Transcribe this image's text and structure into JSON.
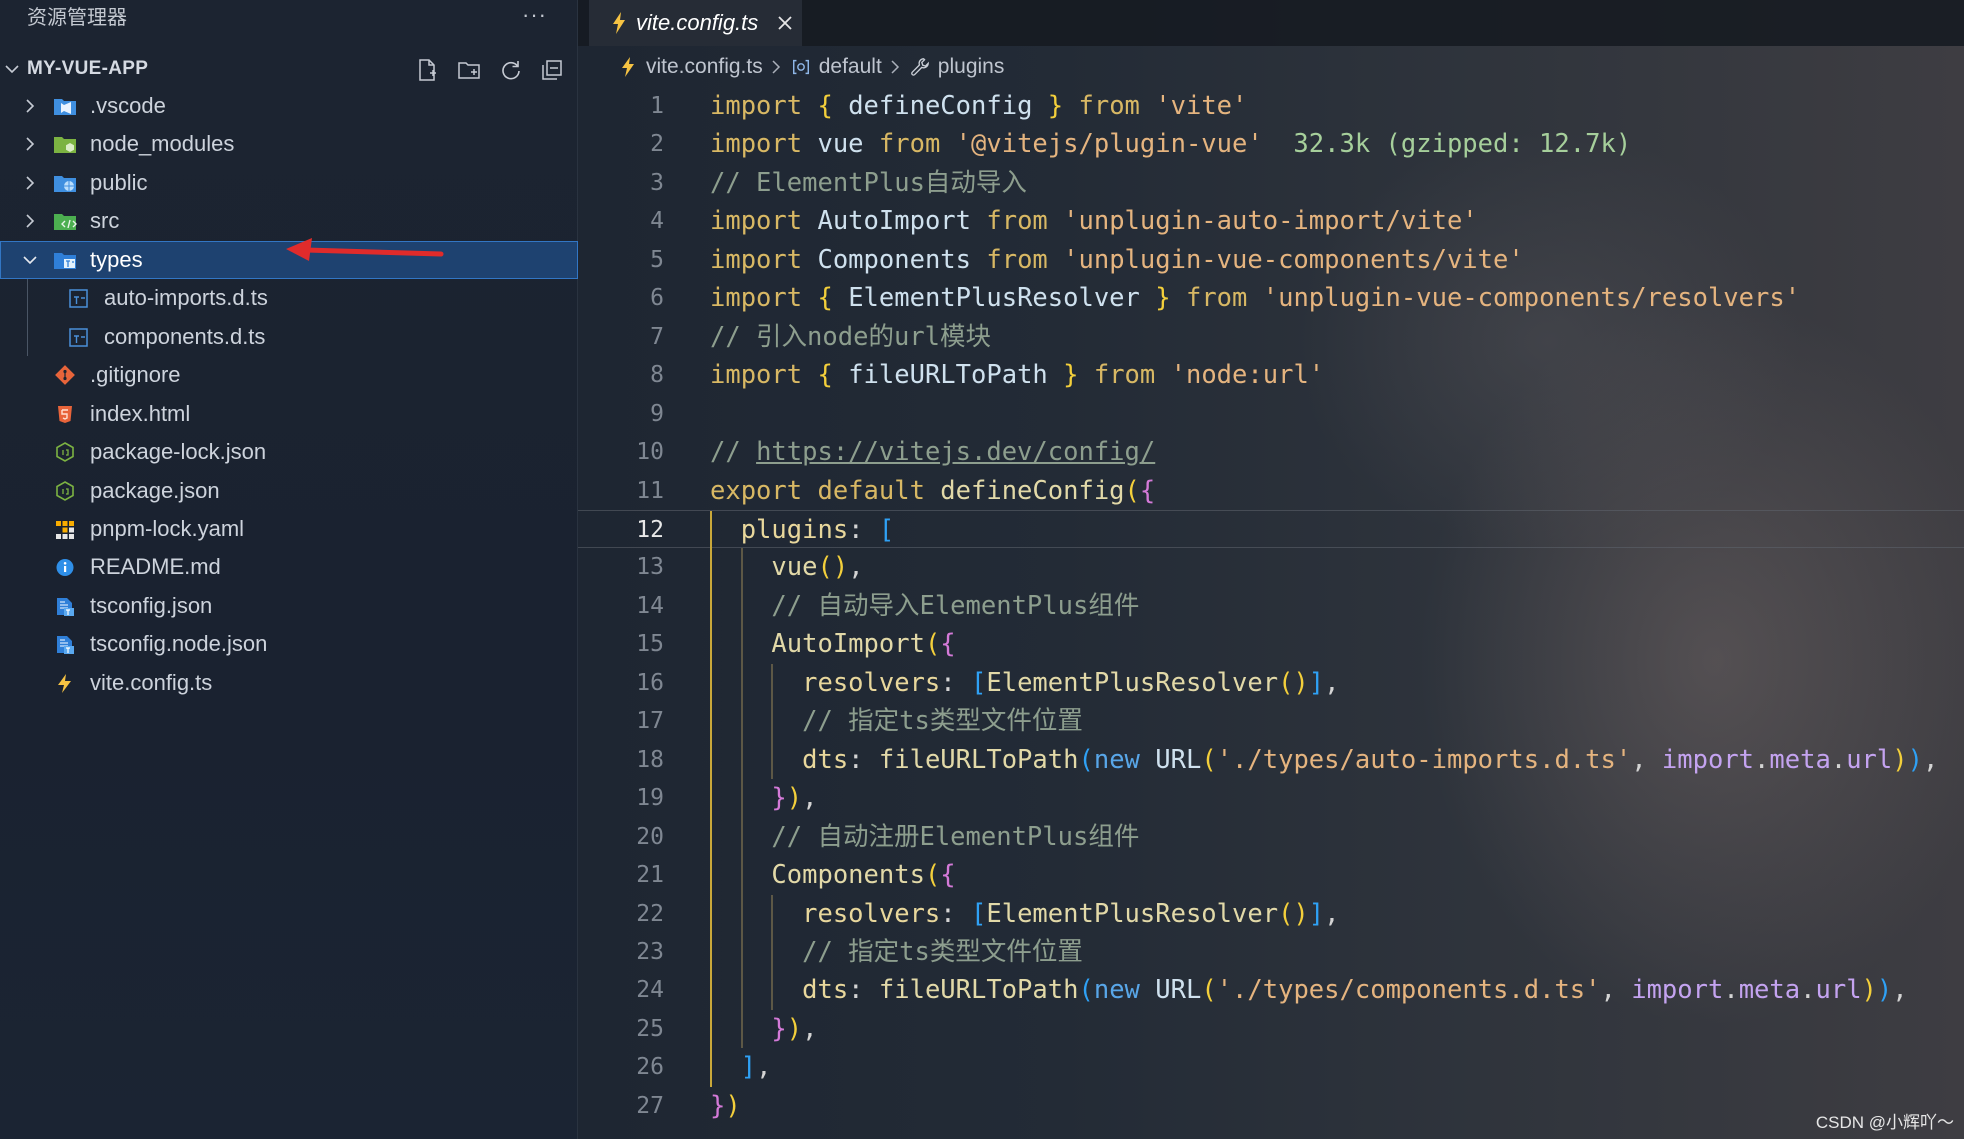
{
  "colors": {
    "selection_bg": "#1e4270",
    "selection_border": "#3276c4",
    "arrow": "#e02b2b",
    "guide_active": "#c9a83a",
    "guide_dim": "#5d5846"
  },
  "sidebar": {
    "title": "资源管理器",
    "more": "···",
    "project": "MY-VUE-APP",
    "header_icons": [
      "new-file-icon",
      "new-folder-icon",
      "refresh-icon",
      "collapse-all-icon"
    ],
    "selected": "types",
    "items": [
      {
        "label": ".vscode",
        "icon": "vscode-folder-icon"
      },
      {
        "label": "node_modules",
        "icon": "node-folder-icon"
      },
      {
        "label": "public",
        "icon": "public-folder-icon"
      },
      {
        "label": "src",
        "icon": "src-folder-icon"
      },
      {
        "label": "types",
        "icon": "types-folder-icon"
      },
      {
        "label": "auto-imports.d.ts",
        "icon": "ts-file-icon"
      },
      {
        "label": "components.d.ts",
        "icon": "ts-file-icon"
      },
      {
        "label": ".gitignore",
        "icon": "git-icon"
      },
      {
        "label": "index.html",
        "icon": "html-icon"
      },
      {
        "label": "package-lock.json",
        "icon": "nodejs-icon"
      },
      {
        "label": "package.json",
        "icon": "nodejs-icon"
      },
      {
        "label": "pnpm-lock.yaml",
        "icon": "pnpm-icon"
      },
      {
        "label": "README.md",
        "icon": "info-icon"
      },
      {
        "label": "tsconfig.json",
        "icon": "tsconfig-icon"
      },
      {
        "label": "tsconfig.node.json",
        "icon": "tsconfig-icon"
      },
      {
        "label": "vite.config.ts",
        "icon": "vite-icon"
      }
    ]
  },
  "editor": {
    "tab": {
      "label": "vite.config.ts",
      "icon": "vite-icon"
    },
    "breadcrumb": [
      {
        "label": "vite.config.ts",
        "icon": "vite-icon"
      },
      {
        "label": "default",
        "icon": "symbol-module-icon"
      },
      {
        "label": "plugins",
        "icon": "wrench-icon"
      }
    ],
    "active_line": 12,
    "lines": [
      {
        "n": 1,
        "tokens": [
          {
            "t": "import",
            "c": "#d8b864"
          },
          {
            "t": " ",
            "c": "#d4d4d4"
          },
          {
            "t": "{",
            "c": "#f3cf3b"
          },
          {
            "t": " defineConfig ",
            "c": "#cfe1ee"
          },
          {
            "t": "}",
            "c": "#f3cf3b"
          },
          {
            "t": " from ",
            "c": "#d8b864"
          },
          {
            "t": "'vite'",
            "c": "#e5b47f"
          }
        ]
      },
      {
        "n": 2,
        "tokens": [
          {
            "t": "import",
            "c": "#d8b864"
          },
          {
            "t": " vue ",
            "c": "#cfe1ee"
          },
          {
            "t": "from",
            "c": "#d8b864"
          },
          {
            "t": " ",
            "c": "#d4d4d4"
          },
          {
            "t": "'@vitejs/plugin-vue'",
            "c": "#e5b47f"
          },
          {
            "t": "  32.3k (gzipped: 12.7k)",
            "c": "#a6cf9b"
          }
        ]
      },
      {
        "n": 3,
        "tokens": [
          {
            "t": "// ElementPlus自动导入",
            "c": "#8d9e8e"
          }
        ]
      },
      {
        "n": 4,
        "tokens": [
          {
            "t": "import",
            "c": "#d8b864"
          },
          {
            "t": " AutoImport ",
            "c": "#cfe1ee"
          },
          {
            "t": "from",
            "c": "#d8b864"
          },
          {
            "t": " ",
            "c": "#d4d4d4"
          },
          {
            "t": "'unplugin-auto-import/vite'",
            "c": "#e5b47f"
          }
        ]
      },
      {
        "n": 5,
        "tokens": [
          {
            "t": "import",
            "c": "#d8b864"
          },
          {
            "t": " Components ",
            "c": "#cfe1ee"
          },
          {
            "t": "from",
            "c": "#d8b864"
          },
          {
            "t": " ",
            "c": "#d4d4d4"
          },
          {
            "t": "'unplugin-vue-components/vite'",
            "c": "#e5b47f"
          }
        ]
      },
      {
        "n": 6,
        "tokens": [
          {
            "t": "import",
            "c": "#d8b864"
          },
          {
            "t": " ",
            "c": "#d4d4d4"
          },
          {
            "t": "{",
            "c": "#f3cf3b"
          },
          {
            "t": " ElementPlusResolver ",
            "c": "#cfe1ee"
          },
          {
            "t": "}",
            "c": "#f3cf3b"
          },
          {
            "t": " from ",
            "c": "#d8b864"
          },
          {
            "t": "'unplugin-vue-components/resolvers'",
            "c": "#e5b47f"
          }
        ]
      },
      {
        "n": 7,
        "tokens": [
          {
            "t": "// 引入node的url模块",
            "c": "#8d9e8e"
          }
        ]
      },
      {
        "n": 8,
        "tokens": [
          {
            "t": "import",
            "c": "#d8b864"
          },
          {
            "t": " ",
            "c": "#d4d4d4"
          },
          {
            "t": "{",
            "c": "#f3cf3b"
          },
          {
            "t": " fileURLToPath ",
            "c": "#cfe1ee"
          },
          {
            "t": "}",
            "c": "#f3cf3b"
          },
          {
            "t": " from ",
            "c": "#d8b864"
          },
          {
            "t": "'node:url'",
            "c": "#e5b47f"
          }
        ]
      },
      {
        "n": 9,
        "tokens": []
      },
      {
        "n": 10,
        "tokens": [
          {
            "t": "// ",
            "c": "#8d9e8e"
          },
          {
            "t": "https://vitejs.dev/config/",
            "c": "#8d9e8e",
            "u": true
          }
        ]
      },
      {
        "n": 11,
        "tokens": [
          {
            "t": "export default ",
            "c": "#d8b864"
          },
          {
            "t": "defineConfig",
            "c": "#e2d9a8"
          },
          {
            "t": "(",
            "c": "#f3cf3b"
          },
          {
            "t": "{",
            "c": "#d47ad8"
          }
        ]
      },
      {
        "n": 12,
        "tokens": [
          {
            "t": "  plugins",
            "c": "#e8d79c"
          },
          {
            "t": ": ",
            "c": "#d4d4d4"
          },
          {
            "t": "[",
            "c": "#2fa1f5"
          }
        ]
      },
      {
        "n": 13,
        "tokens": [
          {
            "t": "    vue",
            "c": "#e2d9a8"
          },
          {
            "t": "()",
            "c": "#f3cf3b"
          },
          {
            "t": ",",
            "c": "#d4d4d4"
          }
        ]
      },
      {
        "n": 14,
        "tokens": [
          {
            "t": "    // 自动导入ElementPlus组件",
            "c": "#8d9e8e"
          }
        ]
      },
      {
        "n": 15,
        "tokens": [
          {
            "t": "    AutoImport",
            "c": "#e2d9a8"
          },
          {
            "t": "(",
            "c": "#f3cf3b"
          },
          {
            "t": "{",
            "c": "#d47ad8"
          }
        ]
      },
      {
        "n": 16,
        "tokens": [
          {
            "t": "      resolvers",
            "c": "#e8d79c"
          },
          {
            "t": ": ",
            "c": "#d4d4d4"
          },
          {
            "t": "[",
            "c": "#2fa1f5"
          },
          {
            "t": "ElementPlusResolver",
            "c": "#e2d9a8"
          },
          {
            "t": "()",
            "c": "#f3cf3b"
          },
          {
            "t": "]",
            "c": "#2fa1f5"
          },
          {
            "t": ",",
            "c": "#d4d4d4"
          }
        ]
      },
      {
        "n": 17,
        "tokens": [
          {
            "t": "      // 指定ts类型文件位置",
            "c": "#8d9e8e"
          }
        ]
      },
      {
        "n": 18,
        "tokens": [
          {
            "t": "      dts",
            "c": "#e8d79c"
          },
          {
            "t": ": ",
            "c": "#d4d4d4"
          },
          {
            "t": "fileURLToPath",
            "c": "#e2d9a8"
          },
          {
            "t": "(",
            "c": "#2fa1f5"
          },
          {
            "t": "new ",
            "c": "#58a6e8"
          },
          {
            "t": "URL",
            "c": "#cfe1ee"
          },
          {
            "t": "(",
            "c": "#f3cf3b"
          },
          {
            "t": "'./types/auto-imports.d.ts'",
            "c": "#e5b47f"
          },
          {
            "t": ", ",
            "c": "#d4d4d4"
          },
          {
            "t": "import",
            "c": "#c4a3f0"
          },
          {
            "t": ".",
            "c": "#d4d4d4"
          },
          {
            "t": "meta",
            "c": "#c4a3f0"
          },
          {
            "t": ".",
            "c": "#d4d4d4"
          },
          {
            "t": "url",
            "c": "#c4a3f0"
          },
          {
            "t": ")",
            "c": "#f3cf3b"
          },
          {
            "t": ")",
            "c": "#2fa1f5"
          },
          {
            "t": ",",
            "c": "#d4d4d4"
          }
        ]
      },
      {
        "n": 19,
        "tokens": [
          {
            "t": "    ",
            "c": "#d4d4d4"
          },
          {
            "t": "}",
            "c": "#d47ad8"
          },
          {
            "t": ")",
            "c": "#f3cf3b"
          },
          {
            "t": ",",
            "c": "#d4d4d4"
          }
        ]
      },
      {
        "n": 20,
        "tokens": [
          {
            "t": "    // 自动注册ElementPlus组件",
            "c": "#8d9e8e"
          }
        ]
      },
      {
        "n": 21,
        "tokens": [
          {
            "t": "    Components",
            "c": "#e2d9a8"
          },
          {
            "t": "(",
            "c": "#f3cf3b"
          },
          {
            "t": "{",
            "c": "#d47ad8"
          }
        ]
      },
      {
        "n": 22,
        "tokens": [
          {
            "t": "      resolvers",
            "c": "#e8d79c"
          },
          {
            "t": ": ",
            "c": "#d4d4d4"
          },
          {
            "t": "[",
            "c": "#2fa1f5"
          },
          {
            "t": "ElementPlusResolver",
            "c": "#e2d9a8"
          },
          {
            "t": "()",
            "c": "#f3cf3b"
          },
          {
            "t": "]",
            "c": "#2fa1f5"
          },
          {
            "t": ",",
            "c": "#d4d4d4"
          }
        ]
      },
      {
        "n": 23,
        "tokens": [
          {
            "t": "      // 指定ts类型文件位置",
            "c": "#8d9e8e"
          }
        ]
      },
      {
        "n": 24,
        "tokens": [
          {
            "t": "      dts",
            "c": "#e8d79c"
          },
          {
            "t": ": ",
            "c": "#d4d4d4"
          },
          {
            "t": "fileURLToPath",
            "c": "#e2d9a8"
          },
          {
            "t": "(",
            "c": "#2fa1f5"
          },
          {
            "t": "new ",
            "c": "#58a6e8"
          },
          {
            "t": "URL",
            "c": "#cfe1ee"
          },
          {
            "t": "(",
            "c": "#f3cf3b"
          },
          {
            "t": "'./types/components.d.ts'",
            "c": "#e5b47f"
          },
          {
            "t": ", ",
            "c": "#d4d4d4"
          },
          {
            "t": "import",
            "c": "#c4a3f0"
          },
          {
            "t": ".",
            "c": "#d4d4d4"
          },
          {
            "t": "meta",
            "c": "#c4a3f0"
          },
          {
            "t": ".",
            "c": "#d4d4d4"
          },
          {
            "t": "url",
            "c": "#c4a3f0"
          },
          {
            "t": ")",
            "c": "#f3cf3b"
          },
          {
            "t": ")",
            "c": "#2fa1f5"
          },
          {
            "t": ",",
            "c": "#d4d4d4"
          }
        ]
      },
      {
        "n": 25,
        "tokens": [
          {
            "t": "    ",
            "c": "#d4d4d4"
          },
          {
            "t": "}",
            "c": "#d47ad8"
          },
          {
            "t": ")",
            "c": "#f3cf3b"
          },
          {
            "t": ",",
            "c": "#d4d4d4"
          }
        ]
      },
      {
        "n": 26,
        "tokens": [
          {
            "t": "  ",
            "c": "#d4d4d4"
          },
          {
            "t": "]",
            "c": "#2fa1f5"
          },
          {
            "t": ",",
            "c": "#d4d4d4"
          }
        ]
      },
      {
        "n": 27,
        "tokens": [
          {
            "t": "}",
            "c": "#d47ad8"
          },
          {
            "t": ")",
            "c": "#f3cf3b"
          }
        ]
      }
    ]
  },
  "watermark": "CSDN @小辉吖～"
}
